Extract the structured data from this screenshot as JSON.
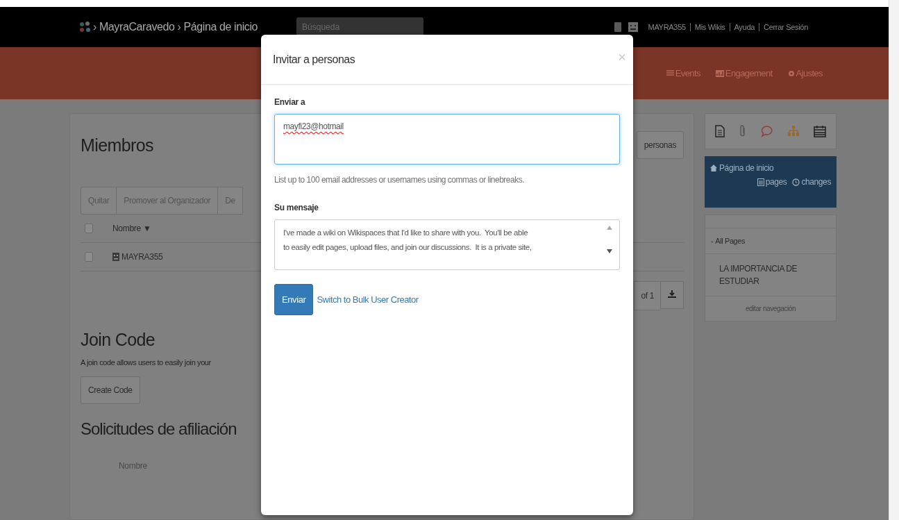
{
  "top_bar": {
    "breadcrumb": [
      {
        "separator": "›",
        "label": "MayraCaravedo"
      },
      {
        "separator": "›",
        "label": "Página de inicio"
      }
    ],
    "search": {
      "placeholder": "Búsqueda"
    },
    "user_links": [
      "MAYRA355",
      "Mis Wikis",
      "Ayuda",
      "Cerrar Sesión"
    ]
  },
  "nav": [
    "Events",
    "Engagement",
    "Ajustes"
  ],
  "members": {
    "title": "Miembros",
    "invite_button": "personas",
    "toolbar": [
      "Quitar",
      "Promover al Organizador",
      "De"
    ],
    "header": {
      "label": "Nombre",
      "sort": "▼",
      "checked": false
    },
    "rows": [
      {
        "name": "MAYRA355",
        "checked": false
      }
    ],
    "pagination": "of 1"
  },
  "join_code": {
    "title": "Join Code",
    "text": "A join code allows users to easily join your",
    "button": "Create Code"
  },
  "requests": {
    "title": "Solicitudes de afiliación",
    "columns": [
      "Nombre"
    ]
  },
  "sidebar": {
    "current_page": {
      "title": "Página de inicio",
      "links": [
        "pages",
        "changes"
      ]
    },
    "navigation": {
      "toggle": "-",
      "heading": "All Pages",
      "items": [
        "LA IMPORTANCIA DE ESTUDIAR"
      ],
      "edit_link": "editar navegación"
    }
  },
  "modal": {
    "title": "Invitar a personas",
    "close": "×",
    "to_label": "Enviar a",
    "to_value": "mayfi23@hotmail",
    "help": "List up to 100 email addresses or usernames using commas or linebreaks.",
    "message_label": "Su mensaje",
    "message": [
      "I've made a wiki on Wikispaces that I'd like to share with you.  You'll be able",
      "to easily edit pages, upload files, and join our discussions.  It is a private site,"
    ],
    "submit": "Enviar",
    "bulk_link": "Switch to Bulk User Creator"
  }
}
